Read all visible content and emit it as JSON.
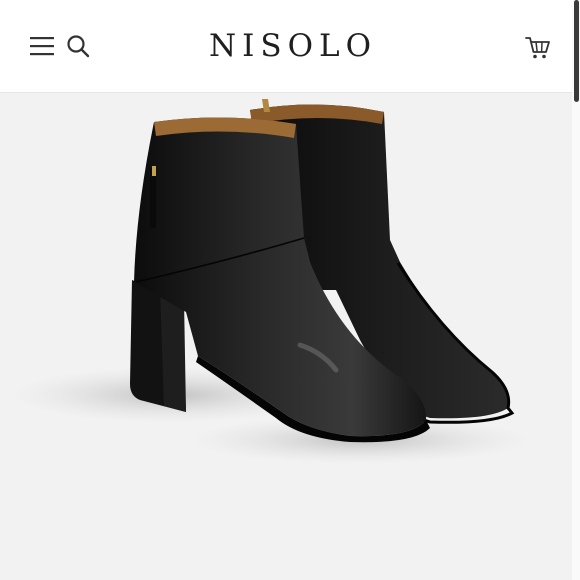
{
  "header": {
    "logo_text": "NISOLO",
    "menu_icon": "hamburger-menu-icon",
    "search_icon": "search-icon",
    "cart_icon": "shopping-cart-icon"
  },
  "product": {
    "image": "black-leather-heeled-ankle-boots"
  },
  "colors": {
    "header_bg": "#ffffff",
    "page_bg": "#f2f2f2",
    "logo": "#1f1f1f",
    "icons": "#333333",
    "boot": "#141414"
  }
}
